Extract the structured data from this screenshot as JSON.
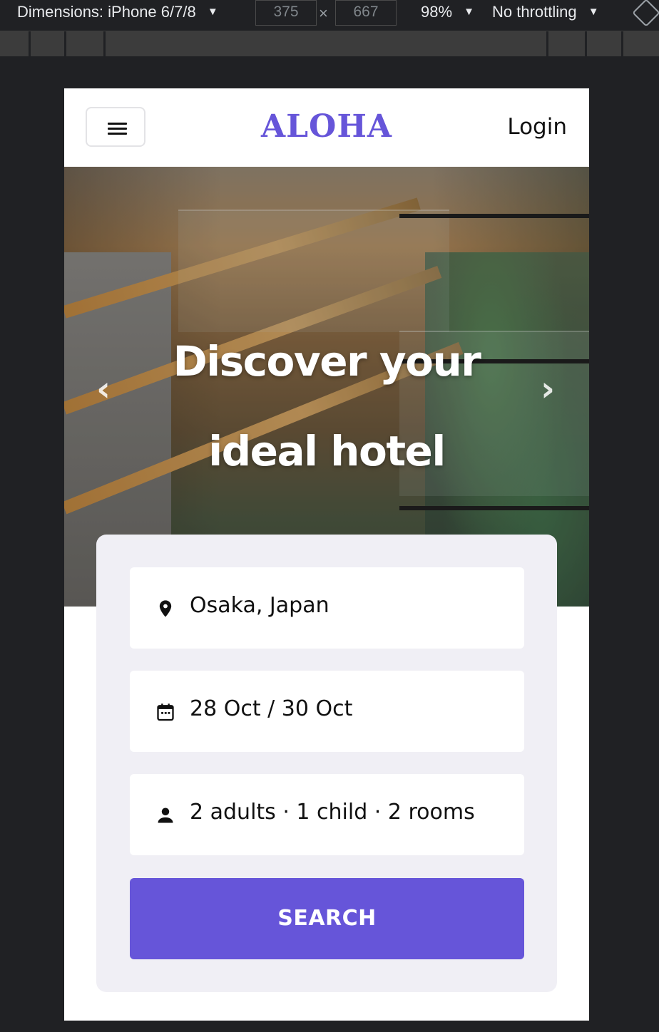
{
  "devtools": {
    "dimensions_label": "Dimensions: iPhone 6/7/8",
    "width": "375",
    "height": "667",
    "times": "×",
    "zoom": "98%",
    "throttling": "No throttling",
    "caret": "▼"
  },
  "header": {
    "logo": "ALOHA",
    "login_label": "Login"
  },
  "hero": {
    "title_line1": "Discover your",
    "title_line2": "ideal hotel",
    "prev_glyph": "‹",
    "next_glyph": "›"
  },
  "search": {
    "location": {
      "icon": "location-pin-icon",
      "value": "Osaka, Japan"
    },
    "dates": {
      "icon": "calendar-icon",
      "value": "28 Oct / 30 Oct"
    },
    "guests": {
      "icon": "person-icon",
      "value": "2 adults · 1 child · 2 rooms"
    },
    "button_label": "SEARCH"
  },
  "colors": {
    "brand": "#6655d9",
    "card_bg": "#f0eff5"
  }
}
